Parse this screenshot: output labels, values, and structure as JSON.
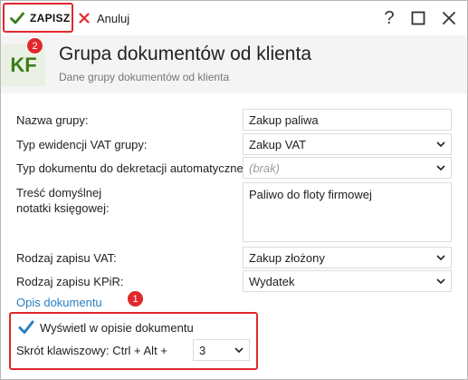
{
  "toolbar": {
    "save_label": "ZAPISZ",
    "cancel_label": "Anuluj",
    "help_label": "?"
  },
  "header": {
    "logo_text": "KF",
    "badge": "2",
    "title": "Grupa dokumentów od klienta",
    "subtitle": "Dane grupy dokumentów od klienta"
  },
  "form": {
    "group_name_label": "Nazwa grupy:",
    "group_name_value": "Zakup paliwa",
    "vat_type_label": "Typ ewidencji VAT grupy:",
    "vat_type_value": "Zakup VAT",
    "doc_type_label": "Typ dokumentu do dekretacji automatycznej:",
    "doc_type_value": "(brak)",
    "note_label_line1": "Treść domyślnej",
    "note_label_line2": "notatki księgowej:",
    "note_value": "Paliwo do floty firmowej",
    "vat_record_label": "Rodzaj zapisu VAT:",
    "vat_record_value": "Zakup złożony",
    "kpir_label": "Rodzaj zapisu KPiR:",
    "kpir_value": "Wydatek"
  },
  "opis": {
    "section_label": "Opis dokumentu",
    "badge": "1",
    "show_label": "Wyświetl w opisie dokumentu",
    "show_checked": true,
    "shortcut_label": "Skrót klawiszowy: Ctrl + Alt +",
    "shortcut_value": "3"
  },
  "colors": {
    "accent_green": "#3a7d19",
    "highlight_red": "#e0282c",
    "link_blue": "#2b7fc0",
    "checkbox_blue": "#2b7fc0"
  }
}
